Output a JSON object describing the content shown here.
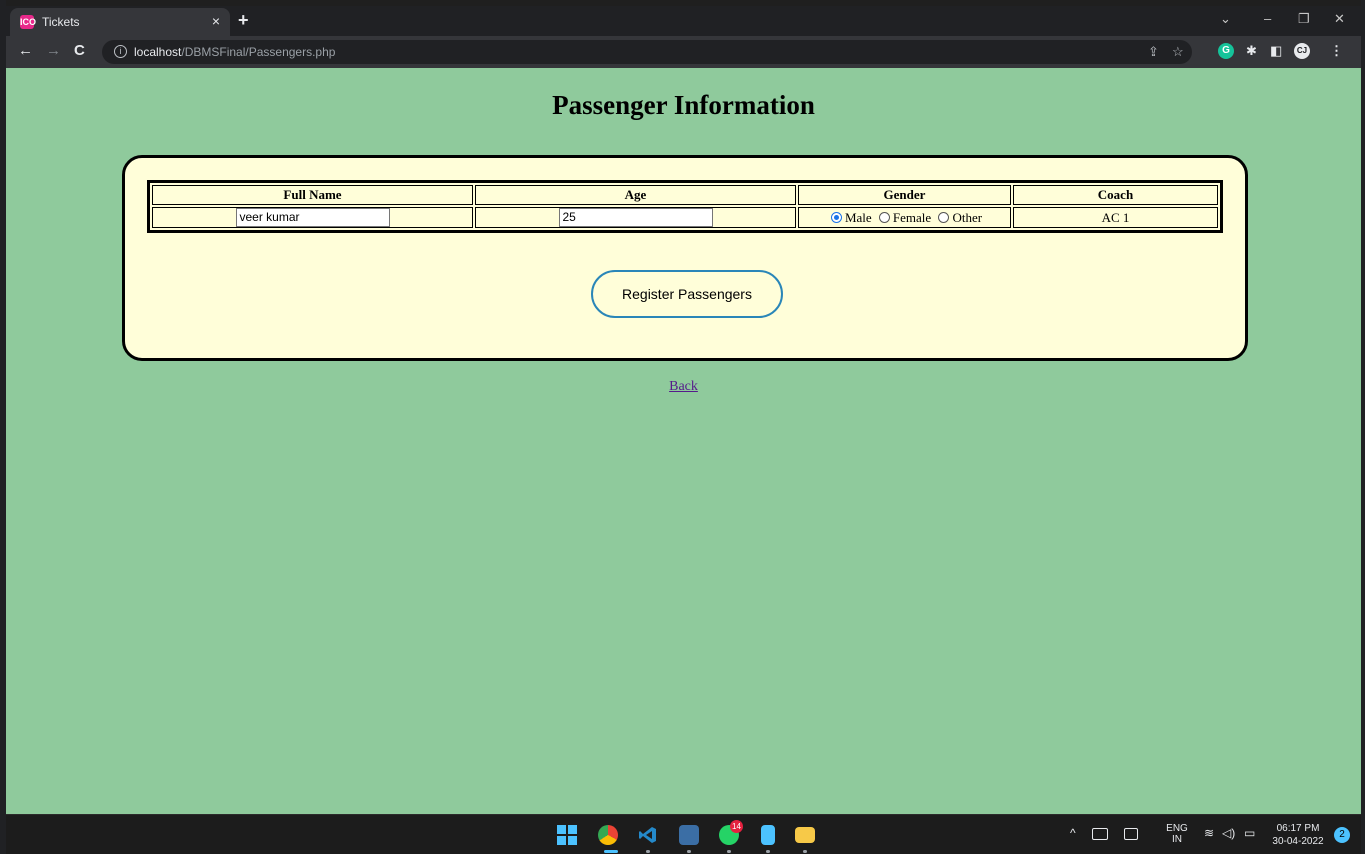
{
  "browser": {
    "tab_title": "Tickets",
    "tab_favicon": "ICO",
    "tab_close": "×",
    "new_tab": "+",
    "url_host": "localhost",
    "url_path": "/DBMSFinal/Passengers.php",
    "icons": {
      "back": "←",
      "forward": "→",
      "reload": "C",
      "info": "i",
      "share": "⇪",
      "star": "☆",
      "grammarly": "G",
      "puzzle": "✱",
      "sidepanel": "◧",
      "profile": "CJ",
      "menu": "⋮",
      "chevron": "⌄",
      "minimize": "–",
      "restore": "❐",
      "close": "✕"
    }
  },
  "page": {
    "title": "Passenger Information",
    "table": {
      "headers": [
        "Full Name",
        "Age",
        "Gender",
        "Coach"
      ],
      "row": {
        "full_name": "veer kumar",
        "age": "25",
        "gender_options": [
          "Male",
          "Female",
          "Other"
        ],
        "gender_selected": "Male",
        "coach": "AC 1"
      }
    },
    "register_button": "Register Passengers",
    "back_link": "Back"
  },
  "taskbar": {
    "whatsapp_badge": "14",
    "tray": {
      "chevron_up": "^",
      "lang_line1": "ENG",
      "lang_line2": "IN",
      "time": "06:17 PM",
      "date": "30-04-2022",
      "notification_count": "2"
    }
  },
  "colors": {
    "page_bg": "#8fca9c",
    "card_bg": "#fffed9",
    "button_border": "#2a86b8",
    "link": "#551a8b"
  }
}
